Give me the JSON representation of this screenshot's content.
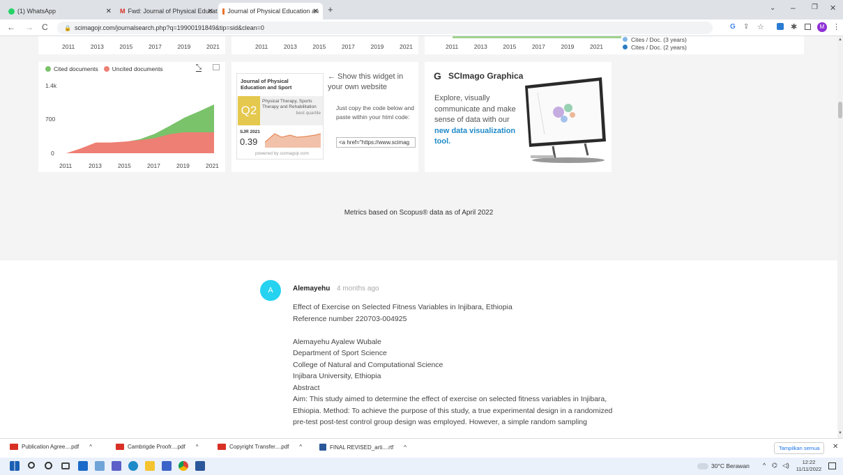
{
  "browser": {
    "tabs": [
      {
        "label": "(1) WhatsApp",
        "icon": "whatsapp-icon"
      },
      {
        "label": "Fwd: Journal of Physical Educatio",
        "icon": "gmail-icon"
      },
      {
        "label": "Journal of Physical Education an",
        "icon": "sjr-icon"
      }
    ],
    "url": "scimagojr.com/journalsearch.php?q=19900191849&tip=sid&clean=0",
    "profile_initial": "M"
  },
  "top_charts": {
    "years": [
      "2011",
      "2013",
      "2015",
      "2017",
      "2019",
      "2021"
    ],
    "legend_cites3": "Cites / Doc. (3 years)",
    "legend_cites2": "Cites / Doc. (2 years)"
  },
  "cited_chart": {
    "legend_cited": "Cited documents",
    "legend_uncited": "Uncited documents",
    "yticks": [
      "1.4k",
      "700",
      "0"
    ],
    "xticks": [
      "2011",
      "2013",
      "2015",
      "2017",
      "2019",
      "2021"
    ],
    "colors": {
      "cited": "#7ac36a",
      "uncited": "#ee7f74"
    },
    "chart_data": {
      "type": "area",
      "x": [
        2011,
        2012,
        2013,
        2014,
        2015,
        2016,
        2017,
        2018,
        2019,
        2020,
        2021
      ],
      "series": [
        {
          "name": "Cited documents",
          "values": [
            0,
            60,
            160,
            200,
            230,
            290,
            400,
            560,
            730,
            860,
            1000
          ]
        },
        {
          "name": "Uncited documents",
          "values": [
            0,
            100,
            220,
            220,
            240,
            270,
            310,
            390,
            430,
            430,
            430
          ]
        }
      ],
      "ylim": [
        0,
        1400
      ]
    }
  },
  "widget": {
    "journal_name": "Journal of Physical Education and Sport",
    "quartile": "Q2",
    "category": "Physical Therapy, Sports Therapy and Rehabilitation",
    "best_quartile": "best quartile",
    "sjr_label": "SJR 2021",
    "sjr_value": "0.39",
    "powered": "powered by scimagojr.com",
    "show_text": "← Show this widget in your own website",
    "copy_text": "Just copy the code below and paste within your html code:",
    "code_value": "<a href=\"https://www.scimag"
  },
  "graphica": {
    "title": "SCImago Graphica",
    "text": "Explore, visually communicate and make sense of data with our",
    "link": "new data visualization tool",
    "period": "."
  },
  "metrics_note": "Metrics based on Scopus® data as of April 2022",
  "comment": {
    "avatar": "A",
    "author": "Alemayehu",
    "time": "4 months ago",
    "lines": [
      "Effect of Exercise on Selected Fitness Variables in Injibara, Ethiopia",
      "Reference number 220703-004925",
      "",
      "Alemayehu Ayalew Wubale",
      "Department of Sport Science",
      "College of Natural and Computational Science",
      "Injibara University, Ethiopia",
      "Abstract",
      "Aim: This study aimed to determine the effect of exercise on selected fitness variables in Injibara,",
      "Ethiopia. Method: To achieve the purpose of this study, a true experimental design in a randomized",
      "pre-test post-test control group design was employed. However, a simple random sampling"
    ]
  },
  "downloads": {
    "items": [
      "Publication Agree....pdf",
      "Cambrigde Proofr....pdf",
      "Copyright Transfer....pdf",
      "FINAL REVISED_arti....rtf"
    ],
    "show_all": "Tampilkan semua"
  },
  "taskbar": {
    "weather": "30°C Berawan",
    "time": "12:22",
    "date": "11/11/2022"
  }
}
